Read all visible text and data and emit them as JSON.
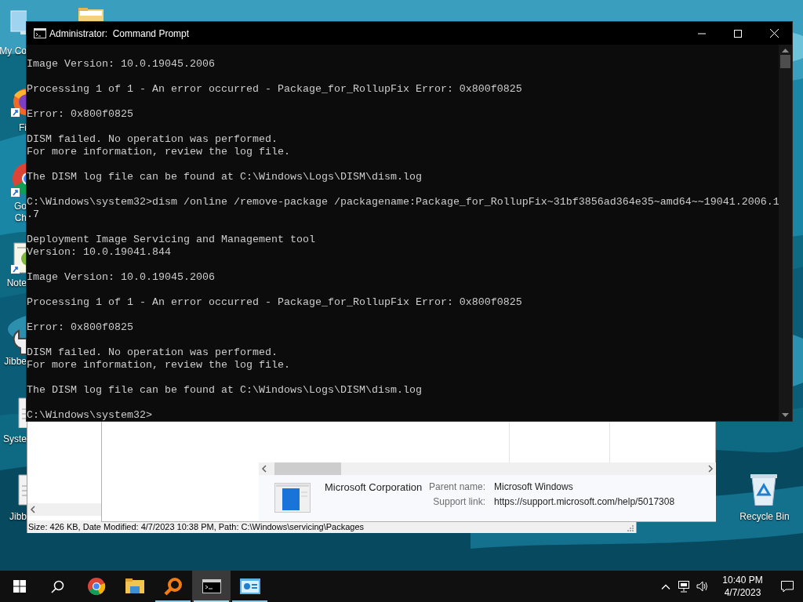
{
  "desktop_icons": [
    {
      "kind": "computer",
      "shortcut": false,
      "label": [
        "My Co"
      ]
    },
    {
      "kind": "folder",
      "shortcut": false
    },
    {
      "kind": "firefox",
      "shortcut": true,
      "label": [
        "Fi"
      ]
    },
    {
      "kind": "chrome",
      "shortcut": true,
      "label": [
        "Go",
        "Ch"
      ]
    },
    {
      "kind": "notepad",
      "shortcut": true,
      "label": [
        "Note"
      ]
    },
    {
      "kind": "tool",
      "shortcut": false,
      "label": [
        "Jibbe"
      ]
    },
    {
      "kind": "document",
      "shortcut": false,
      "label": [
        "Syste"
      ]
    },
    {
      "kind": "document",
      "shortcut": false,
      "label": [
        "Jibb"
      ]
    },
    {
      "kind": "recycle",
      "shortcut": false,
      "label": [
        "Recycle Bin"
      ]
    }
  ],
  "file_window": {
    "status_text": "Size: 426 KB, Date Modified: 4/7/2023 10:38 PM, Path: C:\\Windows\\servicing\\Packages"
  },
  "details_window": {
    "publisher": "Microsoft Corporation",
    "fields": [
      {
        "label": "Parent name:",
        "value": "Microsoft Windows"
      },
      {
        "label": "Support link:",
        "value": "https://support.microsoft.com/help/5017308"
      }
    ]
  },
  "console_window": {
    "title": "Administrator:  Command Prompt",
    "blocks": [
      [
        "Image Version: 10.0.19045.2006"
      ],
      [
        "Processing 1 of 1 - An error occurred - Package_for_RollupFix Error: 0x800f0825"
      ],
      [
        "Error: 0x800f0825"
      ],
      [
        "DISM failed. No operation was performed.",
        "For more information, review the log file."
      ],
      [
        "The DISM log file can be found at C:\\Windows\\Logs\\DISM\\dism.log"
      ],
      [
        "C:\\Windows\\system32>dism /online /remove-package /packagename:Package_for_RollupFix~31bf3856ad364e35~amd64~~19041.2006.1",
        ".7"
      ],
      [
        "Deployment Image Servicing and Management tool",
        "Version: 10.0.19041.844"
      ],
      [
        "Image Version: 10.0.19045.2006"
      ],
      [
        "Processing 1 of 1 - An error occurred - Package_for_RollupFix Error: 0x800f0825"
      ],
      [
        "Error: 0x800f0825"
      ],
      [
        "DISM failed. No operation was performed.",
        "For more information, review the log file."
      ],
      [
        "The DISM log file can be found at C:\\Windows\\Logs\\DISM\\dism.log"
      ],
      [
        "C:\\Windows\\system32>"
      ]
    ]
  },
  "taskbar": {
    "apps": [
      {
        "kind": "start",
        "open": false,
        "selected": false
      },
      {
        "kind": "search",
        "open": false,
        "selected": false
      },
      {
        "kind": "chrome",
        "open": false,
        "selected": false
      },
      {
        "kind": "explorer",
        "open": false,
        "selected": false
      },
      {
        "kind": "magnifier",
        "open": true,
        "selected": false
      },
      {
        "kind": "console",
        "open": true,
        "selected": true
      },
      {
        "kind": "panel",
        "open": true,
        "selected": false
      }
    ],
    "time": "10:40 PM",
    "date": "4/7/2023"
  }
}
